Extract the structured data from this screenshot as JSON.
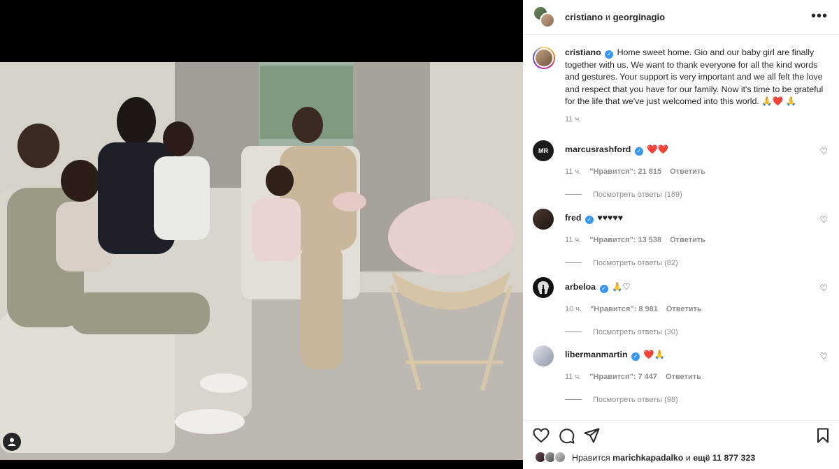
{
  "header": {
    "user1": "cristiano",
    "conjunction": "и",
    "user2": "georginagio",
    "more_icon": "more-horizontal-icon"
  },
  "caption": {
    "username": "cristiano",
    "text": "Home sweet home. Gio and our baby girl are finally together with us. We want to thank everyone for all the kind words and gestures. Your support is very important and we all felt the love and respect that you have for our family. Now it's time to be grateful for the life that we've just welcomed into this world. 🙏❤️ 🙏",
    "time": "11 ч."
  },
  "comments": [
    {
      "username": "marcusrashford",
      "verified": true,
      "text": "❤️❤️",
      "time": "11 ч.",
      "likes": "\"Нравится\": 21 815",
      "reply": "Ответить",
      "view_replies": "Посмотреть ответы (169)"
    },
    {
      "username": "fred",
      "verified": true,
      "text": "♥♥♥♥♥",
      "time": "11 ч.",
      "likes": "\"Нравится\": 13 538",
      "reply": "Ответить",
      "view_replies": "Посмотреть ответы (82)"
    },
    {
      "username": "arbeloa",
      "verified": true,
      "text": "🙏♡",
      "time": "10 ч.",
      "likes": "\"Нравится\": 8 981",
      "reply": "Ответить",
      "view_replies": "Посмотреть ответы (30)"
    },
    {
      "username": "libermanmartin",
      "verified": true,
      "text": "❤️🙏",
      "time": "11 ч.",
      "likes": "\"Нравится\": 7 447",
      "reply": "Ответить",
      "view_replies": "Посмотреть ответы (98)"
    }
  ],
  "likes_line": {
    "prefix": "Нравится",
    "user": "marichkapadalko",
    "conjunction": "и",
    "rest": "ещё 11 877 323"
  },
  "icons": {
    "like": "heart-icon",
    "comment": "comment-icon",
    "share": "send-icon",
    "save": "bookmark-icon",
    "tag": "user-tag-icon"
  },
  "colors": {
    "verified": "#3897f0",
    "secondary_text": "#8e8e8e",
    "heart_red": "#ed4956"
  }
}
